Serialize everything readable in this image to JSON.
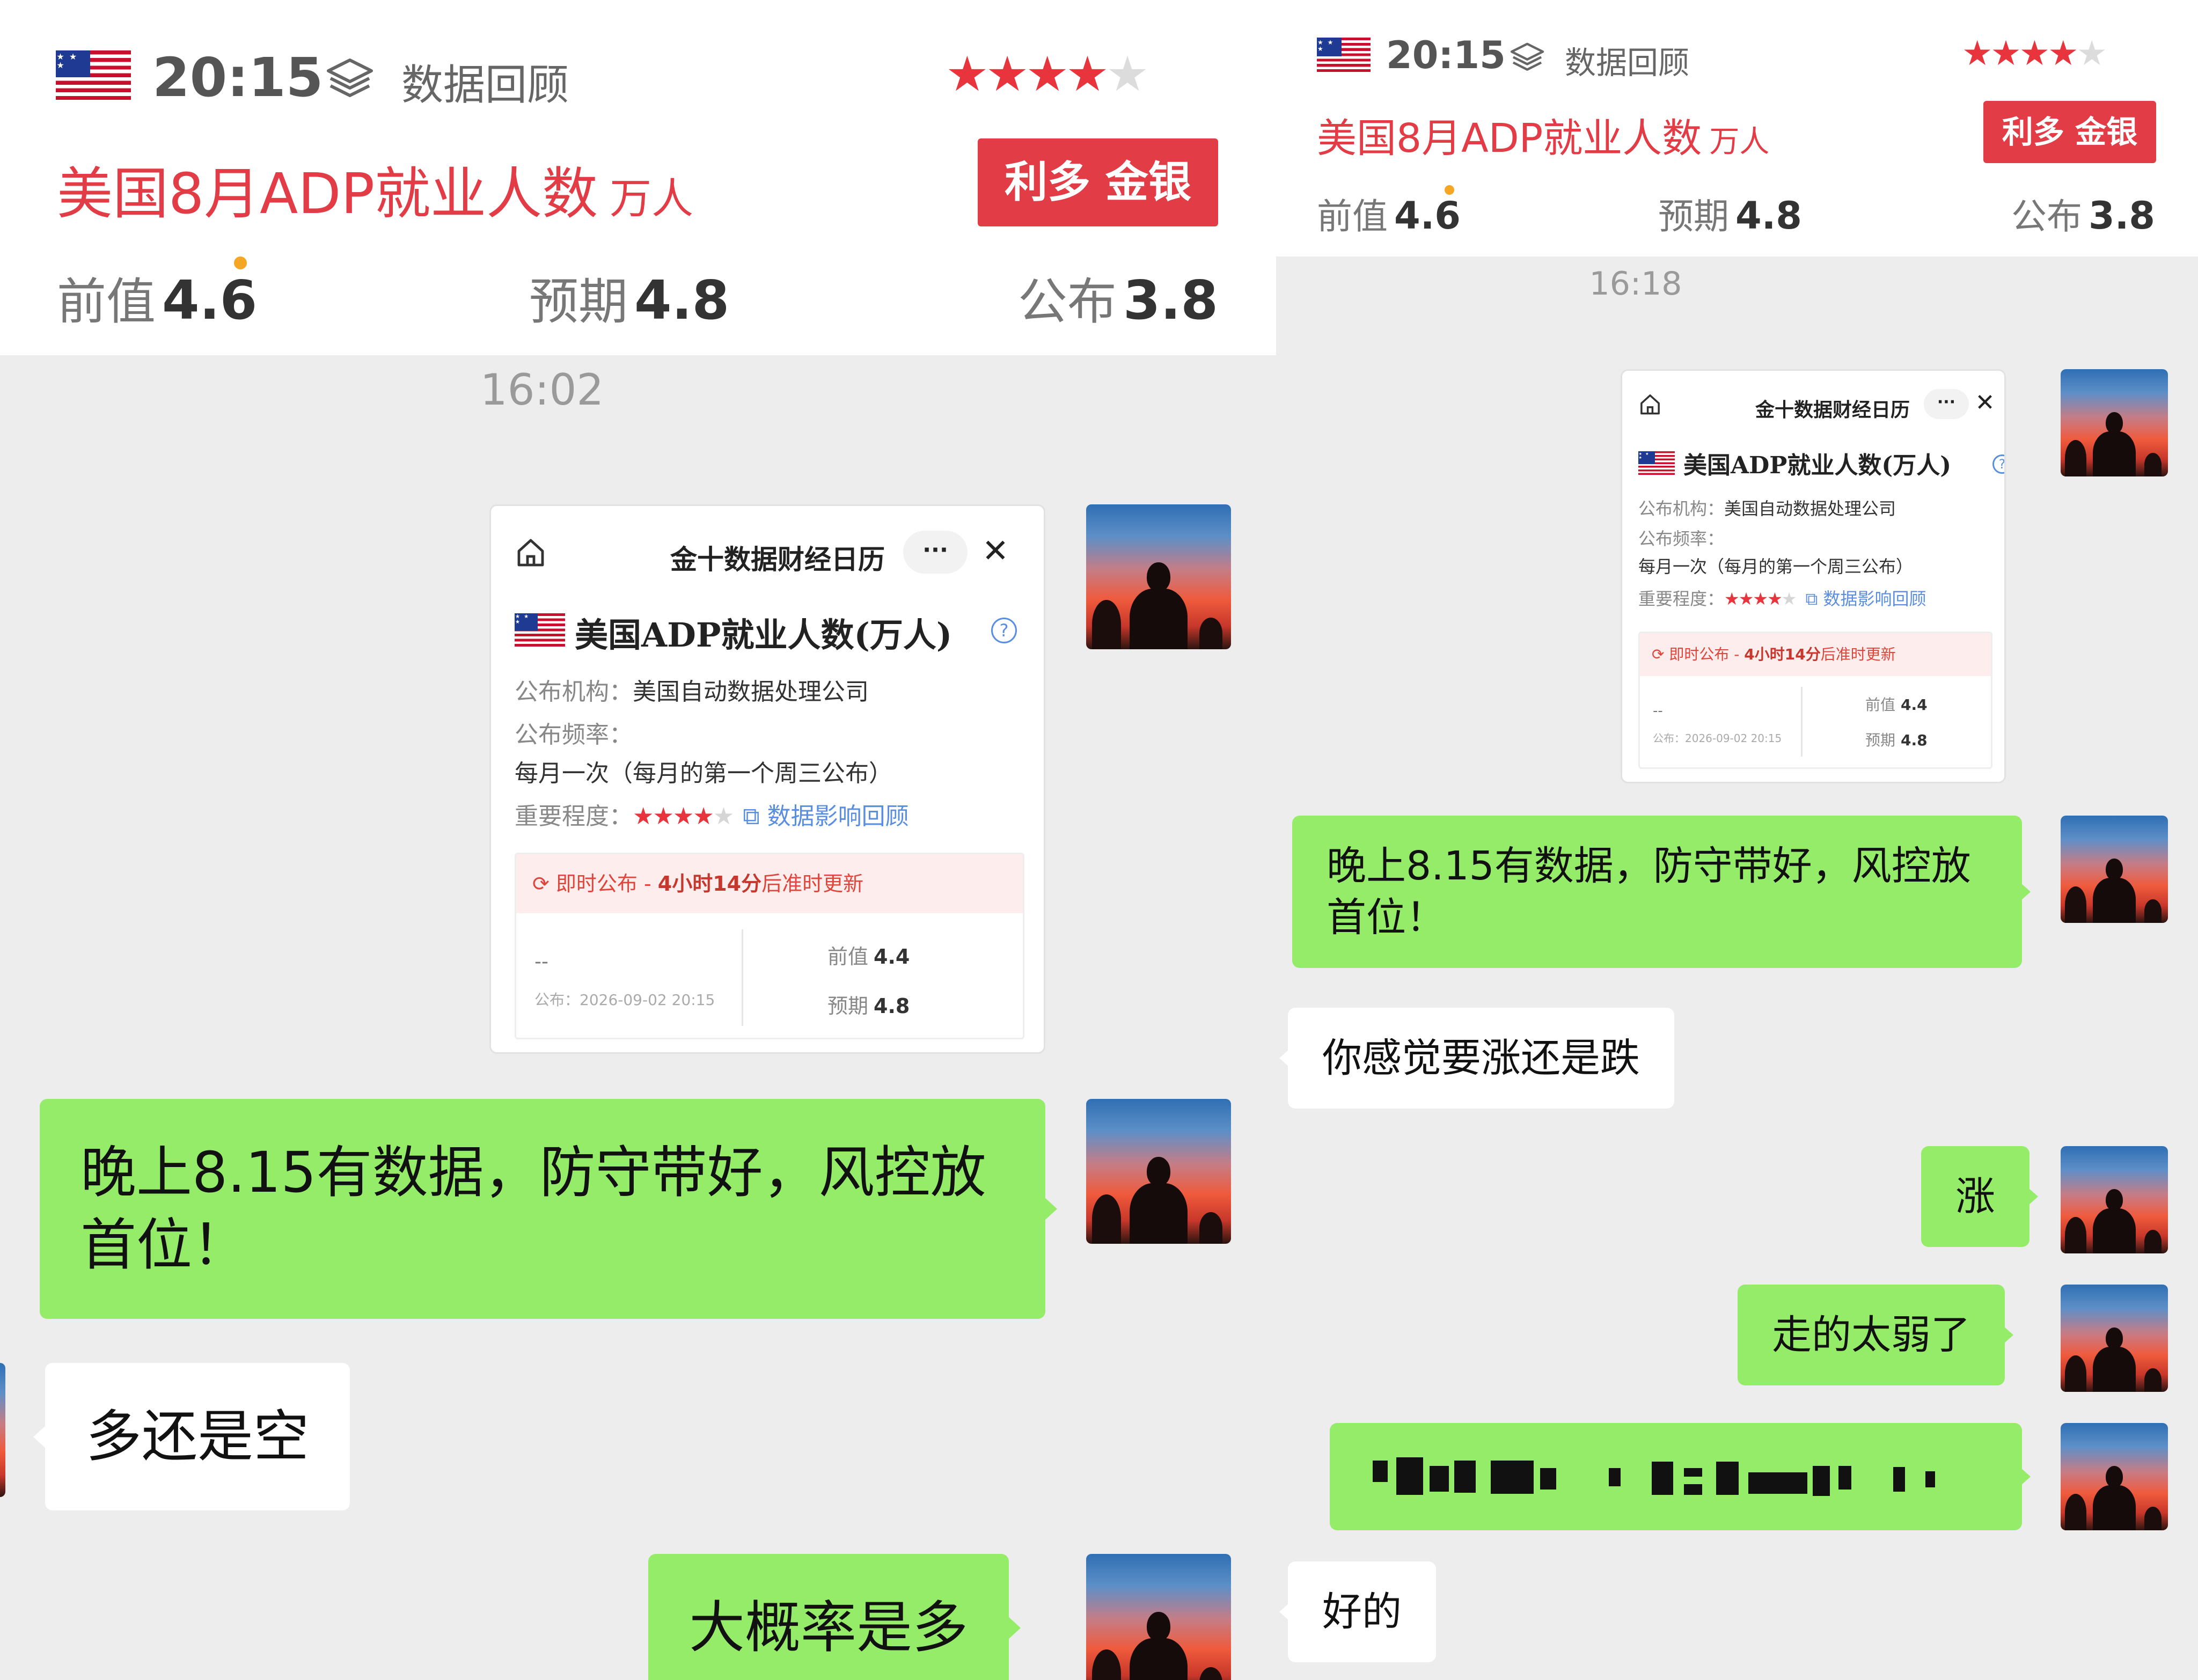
{
  "header": {
    "time": "20:15",
    "review_label": "数据回顾",
    "importance_stars": 4,
    "importance_max": 5,
    "event_title": "美国8月ADP就业人数",
    "event_unit": "万人",
    "impact_label": "利多 金银",
    "previous": {
      "label": "前值",
      "value": "4.6"
    },
    "expected": {
      "label": "预期",
      "value": "4.8"
    },
    "actual": {
      "label": "公布",
      "value": "3.8"
    }
  },
  "card": {
    "title": "金十数据财经日历",
    "more_label": "···",
    "close_label": "✕",
    "indicator_name": "美国ADP就业人数(万人)",
    "help_label": "?",
    "publisher_label": "公布机构：",
    "publisher_value": "美国自动数据处理公司",
    "frequency_label": "公布频率：",
    "frequency_value": "每月一次（每月的第一个周三公布）",
    "importance_label": "重要程度：",
    "importance_stars": 4,
    "review_link": "数据影响回顾",
    "alert_prefix": "即时公布 - ",
    "alert_time": "4小时14分",
    "alert_suffix": "后准时更新",
    "actual_placeholder": "--",
    "publish_time": "公布：2026-09-02 20:15",
    "previous_label": "前值",
    "previous_value": "4.4",
    "expected_label": "预期",
    "expected_value": "4.8"
  },
  "left_chat": {
    "timestamp": "16:02",
    "messages": [
      {
        "side": "sent",
        "text": "晚上8.15有数据，防守带好，风控放首位！"
      },
      {
        "side": "received",
        "text": "多还是空"
      },
      {
        "side": "sent",
        "text": "大概率是多"
      }
    ]
  },
  "right_chat": {
    "timestamp": "16:18",
    "messages": [
      {
        "side": "sent",
        "text": "晚上8.15有数据，防守带好，风控放首位！"
      },
      {
        "side": "received",
        "text": "你感觉要涨还是跌"
      },
      {
        "side": "sent",
        "text": "涨"
      },
      {
        "side": "sent",
        "text": "走的太弱了"
      },
      {
        "side": "sent",
        "text": "",
        "redacted": true
      },
      {
        "side": "received",
        "text": "好的"
      }
    ]
  },
  "colors": {
    "accent_red": "#e23c46",
    "bubble_green": "#95ec69",
    "chat_background": "#ededed",
    "link_blue": "#5a8ee0"
  },
  "icons": [
    "us-flag-icon",
    "layers-icon",
    "star-icon",
    "home-icon",
    "more-icon",
    "close-icon",
    "help-icon",
    "alert-clock-icon",
    "avatar"
  ]
}
